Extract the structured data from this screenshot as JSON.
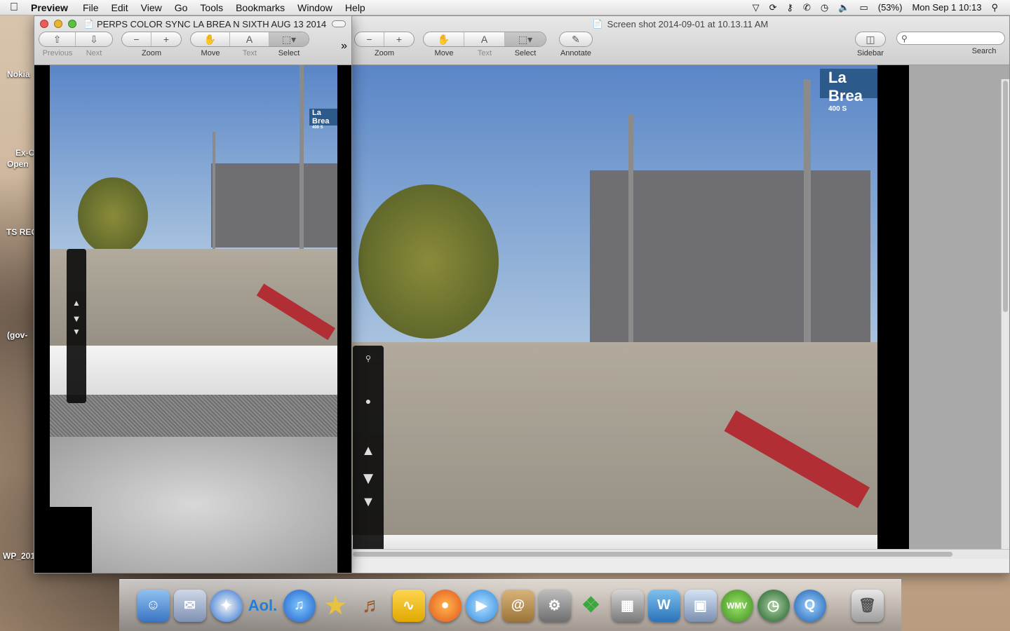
{
  "menubar": {
    "apple_icon": "apple-icon",
    "app_name": "Preview",
    "menus": [
      "File",
      "Edit",
      "View",
      "Go",
      "Tools",
      "Bookmarks",
      "Window",
      "Help"
    ],
    "battery": "(53%)",
    "clock": "Mon Sep 1  10:13"
  },
  "desktop": {
    "labels": [
      "Nokia",
      "Ex-C",
      "Open",
      "TS REC",
      "(gov-",
      "WP_201"
    ]
  },
  "window_left": {
    "title": "PERPS COLOR SYNC LA BREA N SIXTH AUG 13 2014",
    "toolbar": {
      "previous": "Previous",
      "next": "Next",
      "zoom": "Zoom",
      "move": "Move",
      "text": "Text",
      "select": "Select",
      "overflow": "»"
    },
    "street_sign": "La Brea",
    "street_sign_sub": "400 S"
  },
  "window_right": {
    "title": "Screen shot 2014-09-01 at 10.13.11 AM",
    "toolbar": {
      "zoom": "Zoom",
      "move": "Move",
      "text": "Text",
      "select": "Select",
      "annotate": "Annotate",
      "sidebar": "Sidebar",
      "search": "Search"
    },
    "street_sign": "La Brea",
    "street_sign_sub": "400 S"
  },
  "dock": {
    "apps": [
      "finder-icon",
      "mail-icon",
      "safari-icon",
      "aol-icon",
      "itunes-icon",
      "imovie-icon",
      "garageband-icon",
      "audio-icon",
      "firefox-icon",
      "facetime-icon",
      "address-book-icon",
      "system-preferences-icon",
      "office-icon",
      "photo-booth-icon",
      "word-icon",
      "iphoto-icon",
      "wmv-icon",
      "time-machine-icon",
      "quicktime-icon",
      "trash-icon"
    ],
    "aol_label": "Aol.",
    "wmv_label": "WMV"
  }
}
